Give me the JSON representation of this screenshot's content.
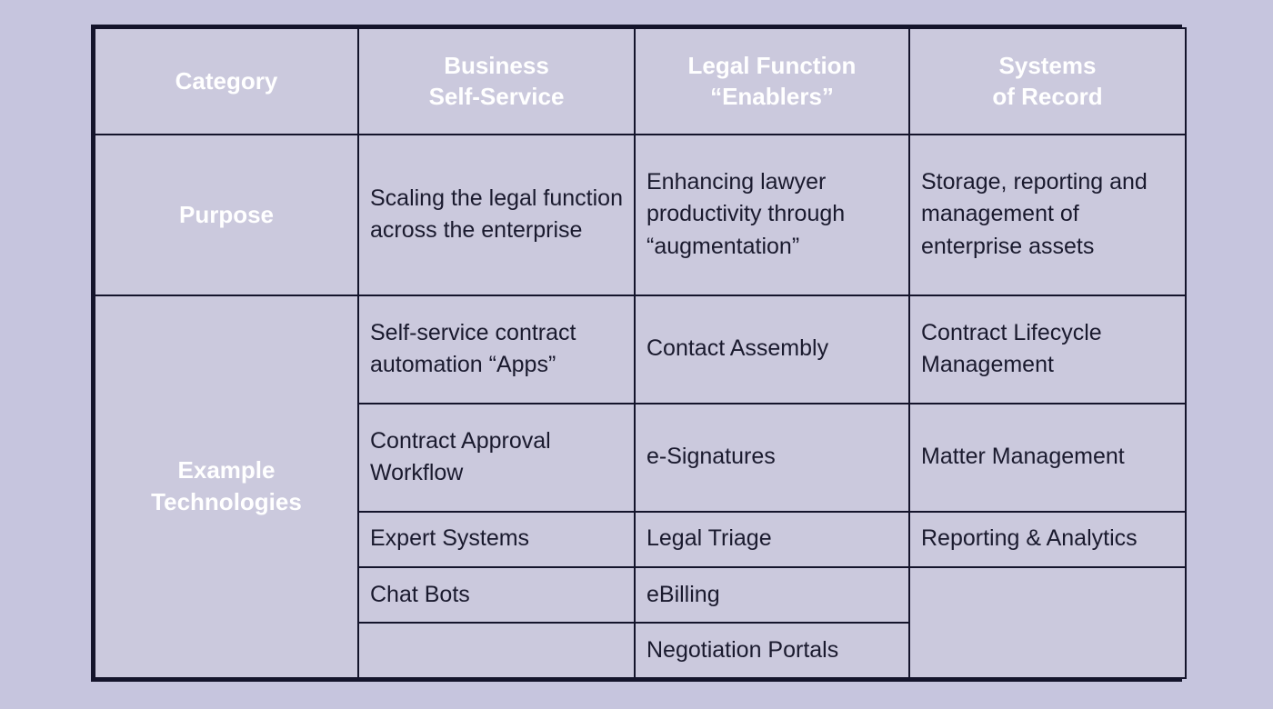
{
  "colors": {
    "page_background": "#c6c5de",
    "header_fill": "#61618f",
    "cell_fill": "#cbc9dd",
    "border": "#14142b",
    "header_text": "#ffffff",
    "body_text": "#1a1a2e"
  },
  "table": {
    "headers": {
      "category": "Category",
      "business": "Business\nSelf-Service",
      "legal": "Legal Function\n“Enablers”",
      "systems": "Systems\nof Record"
    },
    "purpose": {
      "label": "Purpose",
      "business": "Scaling the legal function across the enterprise",
      "legal": "Enhancing lawyer productivity through “augmentation”",
      "systems": "Storage, reporting and management of enterprise assets"
    },
    "example_technologies": {
      "label": "Example\nTechnologies",
      "rows": [
        {
          "business": "Self-service contract automation “Apps”",
          "legal": "Contact Assembly",
          "systems": "Contract Lifecycle Management"
        },
        {
          "business": "Contract Approval Workflow",
          "legal": "e-Signatures",
          "systems": "Matter Management"
        },
        {
          "business": "Expert Systems",
          "legal": "Legal Triage",
          "systems": "Reporting & Analytics"
        },
        {
          "business": "Chat Bots",
          "legal": "eBilling",
          "systems": ""
        },
        {
          "business": "",
          "legal": "Negotiation Portals",
          "systems": ""
        }
      ]
    }
  }
}
